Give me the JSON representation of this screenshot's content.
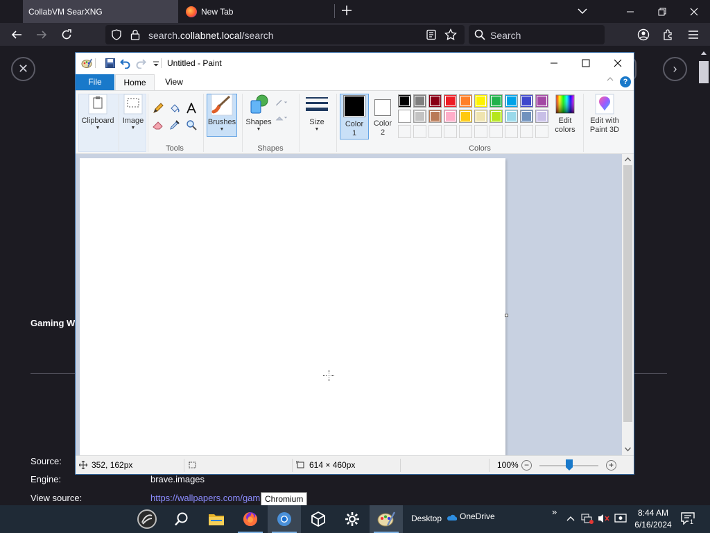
{
  "browser": {
    "tabs": [
      {
        "title": "CollabVM SearXNG",
        "active": true
      },
      {
        "title": "New Tab",
        "active": false
      }
    ],
    "url_prefix": "search.",
    "url_host": "collabnet.local",
    "url_path": "/search",
    "search_placeholder": "Search"
  },
  "page": {
    "result_title": "Gaming W",
    "meta": [
      {
        "label": "Source:",
        "value": ""
      },
      {
        "label": "Engine:",
        "value": "brave.images"
      },
      {
        "label": "View source:",
        "value": "https://wallpapers.com/gam"
      }
    ],
    "tooltip": "Chromium"
  },
  "paint": {
    "title": "Untitled - Paint",
    "menu_tabs": {
      "file": "File",
      "home": "Home",
      "view": "View"
    },
    "help": "?",
    "ribbon": {
      "clipboard": "Clipboard",
      "image": "Image",
      "tools_group": "Tools",
      "brushes": "Brushes",
      "shapes": "Shapes",
      "shapes_group": "Shapes",
      "size": "Size",
      "color1_line1": "Color",
      "color1_line2": "1",
      "color2_line1": "Color",
      "color2_line2": "2",
      "colors_group": "Colors",
      "edit_colors_line1": "Edit",
      "edit_colors_line2": "colors",
      "paint3d_line1": "Edit with",
      "paint3d_line2": "Paint 3D"
    },
    "color1": "#000000",
    "color2": "#ffffff",
    "palette_row1": [
      "#000000",
      "#7f7f7f",
      "#880015",
      "#ed1c24",
      "#ff7f27",
      "#fff200",
      "#22b14c",
      "#00a2e8",
      "#3f48cc",
      "#a349a4"
    ],
    "palette_row2": [
      "#ffffff",
      "#c3c3c3",
      "#b97a57",
      "#ffaec9",
      "#ffc90e",
      "#efe4b0",
      "#b5e61d",
      "#99d9ea",
      "#7092be",
      "#c8bfe7"
    ],
    "status": {
      "cursor_pos": "352, 162px",
      "image_size": "614 × 460px",
      "zoom": "100%"
    }
  },
  "taskbar": {
    "desktop": "Desktop",
    "onedrive": "OneDrive",
    "time": "8:44 AM",
    "date": "6/16/2024",
    "notif_count": "1"
  }
}
